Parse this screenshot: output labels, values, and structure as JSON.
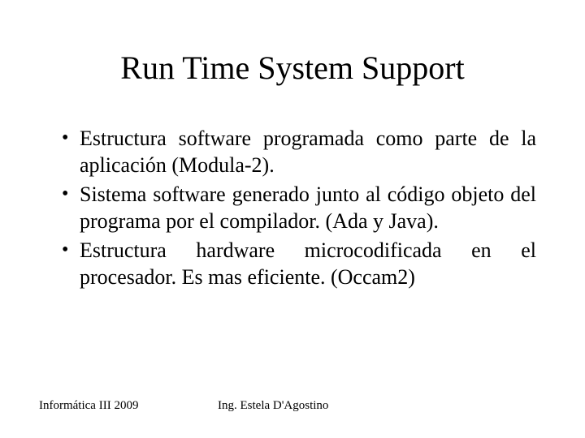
{
  "title": "Run Time System Support",
  "bullets": [
    "Estructura software programada como parte de la aplicación (Modula-2).",
    "Sistema software generado junto al código objeto del programa por el compilador. (Ada y Java).",
    "Estructura hardware microcodificada en el procesador. Es mas eficiente. (Occam2)"
  ],
  "footer": {
    "left": "Informática III 2009",
    "center": "Ing. Estela D'Agostino"
  }
}
